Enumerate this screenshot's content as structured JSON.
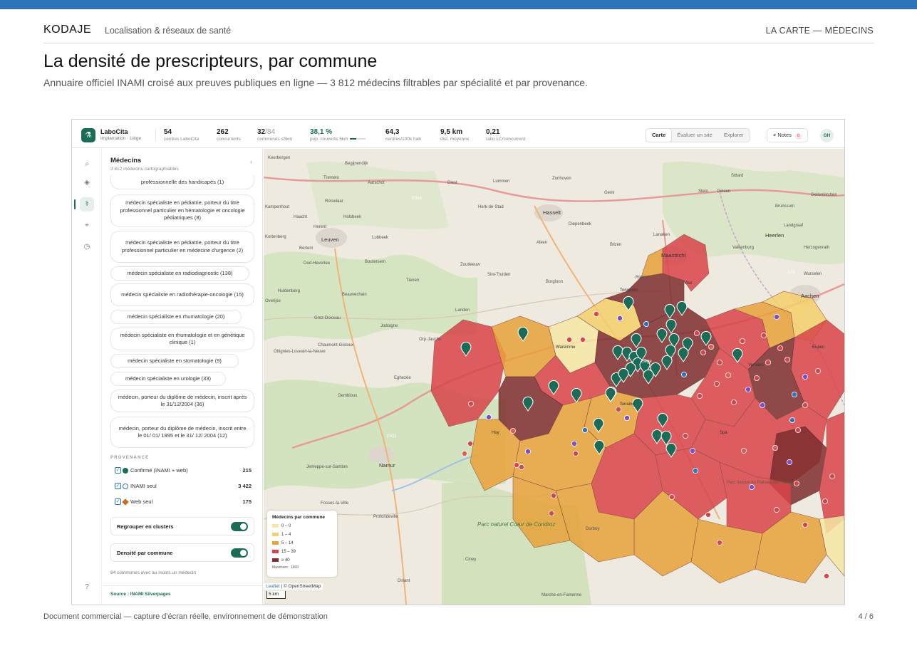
{
  "doc": {
    "brand": "KODAJE",
    "brand_sub": "Localisation & réseaux de santé",
    "crumb": "LA CARTE — MÉDECINS",
    "title": "La densité de prescripteurs, par commune",
    "subtitle": "Annuaire officiel INAMI croisé aux preuves publiques en ligne — 3 812 médecins filtrables par spécialité et par provenance.",
    "footer_left": "Document commercial — capture d'écran réelle, environnement de démonstration",
    "footer_right": "4 / 6"
  },
  "colors": {
    "accent": "#2e74b9",
    "brand_green": "#1b6c57",
    "density": [
      "#f6e8a6",
      "#f5cf6b",
      "#e8a23a",
      "#d9444a",
      "#7e2e2e"
    ]
  },
  "app": {
    "name": "LaboCita",
    "sub": "Implantation · Liège",
    "kpis": [
      {
        "value": "54",
        "label": "centres LaboCita"
      },
      {
        "value": "262",
        "label": "concurrents"
      },
      {
        "value": "32",
        "value_dim": "/84",
        "label": "communes ≤5km"
      },
      {
        "value": "38,1 %",
        "label": "pop. couverte 5km",
        "progress": 0.381
      },
      {
        "value": "64,3",
        "label": "centres/100k hab."
      },
      {
        "value": "9,5 km",
        "label": "dist. moyenne"
      },
      {
        "value": "0,21",
        "label": "ratio LC/concurrent"
      }
    ],
    "tabs": [
      "Carte",
      "Évaluer un site",
      "Explorer"
    ],
    "active_tab": "Carte",
    "notes_label": "Notes",
    "notes_count": "0",
    "avatar": "GH"
  },
  "rail": [
    "search-icon",
    "layers-icon",
    "user-plus-icon",
    "pin-icon",
    "clock-icon",
    "help-icon"
  ],
  "panel": {
    "title": "Médecins",
    "sub": "3 812 médecins cartographiables",
    "specialties": [
      "professionnelle des handicapés (1)",
      "médecin spécialiste en pédiatrie, porteur du titre professionnel particulier en hématologie et oncologie pédiatriques (8)",
      "médecin spécialiste en pédiatrie, porteur du titre professionnel particulier en médecine d'urgence (2)",
      "médecin spécialiste en radiodiagnostic (138)",
      "médecin spécialiste en radiothérapie-oncologie (15)",
      "médecin spécialiste en rhumatologie (20)",
      "médecin spécialiste en rhumatologie et en génétique clinique (1)",
      "médecin spécialiste en stomatologie (9)",
      "médecin spécialiste en urologie (33)",
      "médecin, porteur du diplôme de médecin, inscrit après le 31/12/2004 (36)",
      "médecin, porteur du diplôme de médecin, inscrit entre le 01/ 01/ 1995 et le 31/ 12/ 2004 (12)"
    ],
    "provenance_label": "PROVENANCE",
    "provenance": [
      {
        "label": "Confirmé (INAMI + web)",
        "count": "215",
        "symbol": "filled-circle"
      },
      {
        "label": "INAMI seul",
        "count": "3 422",
        "symbol": "hollow-circle"
      },
      {
        "label": "Web seul",
        "count": "175",
        "symbol": "diamond"
      }
    ],
    "toggles": [
      {
        "label": "Regrouper en clusters",
        "on": true
      },
      {
        "label": "Densité par commune",
        "on": true
      }
    ],
    "note": "84 communes avec au moins un médecin",
    "source": "Source : INAMI Silverpages"
  },
  "map": {
    "places": [
      "Keerbergen",
      "Begijnendijk",
      "Tremelo",
      "Aarschot",
      "Diest",
      "Lummen",
      "Zonhoven",
      "Genk",
      "Sittard",
      "Stein",
      "Geleen",
      "Geilenkirchen",
      "Brunssum",
      "Kampenhout",
      "Rotselaar",
      "Herk-de-Stad",
      "Hasselt",
      "Landgraaf",
      "Haacht",
      "Holsbeek",
      "Diepenbeek",
      "Heerlen",
      "Herent",
      "Lubbeek",
      "Lanaken",
      "Kortenberg",
      "Bertem",
      "Leuven",
      "Bilzen",
      "Valkenburg",
      "Herzogenrath",
      "Boutersem",
      "Alken",
      "Maastricht",
      "Dud-Heverlee",
      "Zoutleeuw",
      "Sint-Truiden",
      "Tienen",
      "Borgloon",
      "Riemst",
      "Wurselen",
      "Huldenberg",
      "Beauvechain",
      "Overijse",
      "Aachen",
      "Landen",
      "Grez-Doiceau",
      "Jodoigne",
      "Orp-Jauche",
      "Chaumont-Gistoux",
      "Ottignies-Louvain-la-Neuve",
      "Eghezée",
      "Gembloux",
      "Namur",
      "Jemeppe-sur-Sambre",
      "Fosses-la-Ville",
      "Profondeville",
      "Durbuy",
      "Ciney",
      "Dinant",
      "Marche-en-Famenne",
      "Parc naturel Cœur de Condroz",
      "Parc naturel du Plateau des Tailles",
      "E314",
      "A76",
      "E411",
      "Eupen",
      "Verviers",
      "Liège",
      "Seraing",
      "Spa",
      "Huy",
      "Waremme",
      "Tongeren",
      "Visé"
    ],
    "legend_title": "Médecins par commune",
    "legend": [
      {
        "label": "0 – 0",
        "color": "#f6e8a6"
      },
      {
        "label": "1 – 4",
        "color": "#f5cf6b"
      },
      {
        "label": "5 – 14",
        "color": "#e8a23a"
      },
      {
        "label": "15 – 39",
        "color": "#d9444a"
      },
      {
        "label": "≥ 40",
        "color": "#7e2e2e"
      }
    ],
    "legend_max": "Maximum : 1669",
    "attribution_leaflet": "Leaflet",
    "attribution_osm": "© OpenStreetMap",
    "scale": "5 km"
  }
}
